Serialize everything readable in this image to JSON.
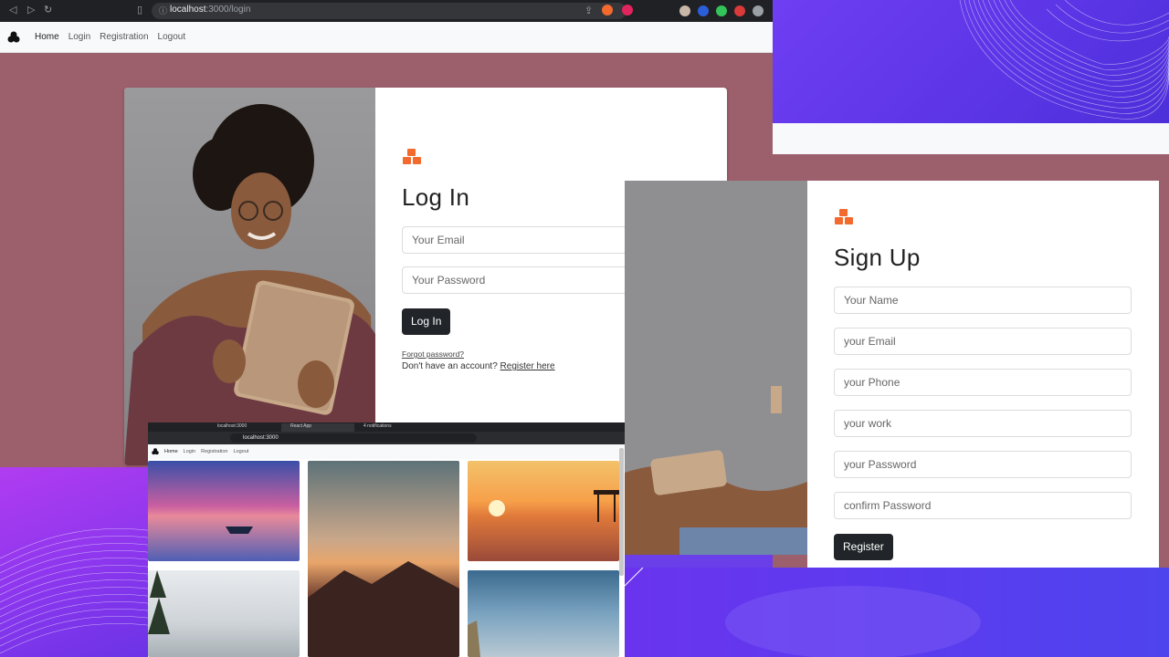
{
  "login_window": {
    "url_host": "localhost",
    "url_path": ":3000/login",
    "nav": {
      "items": [
        "Home",
        "Login",
        "Registration",
        "Logout"
      ]
    },
    "form": {
      "title": "Log In",
      "email_placeholder": "Your Email",
      "password_placeholder": "Your Password",
      "submit_label": "Log In",
      "forgot_link": "Forgot password?",
      "no_account_text": "Don't have an account?",
      "register_link": "Register here"
    }
  },
  "signup_window": {
    "form": {
      "title": "Sign Up",
      "name_placeholder": "Your Name",
      "email_placeholder": "your Email",
      "phone_placeholder": "your Phone",
      "work_placeholder": "your work",
      "password_placeholder": "your Password",
      "confirm_placeholder": "confirm Password",
      "submit_label": "Register"
    }
  },
  "gallery_window": {
    "tabs": [
      "localhost:3000",
      "React App",
      "4 notifications"
    ],
    "url": "localhost:3000",
    "nav": {
      "items": [
        "Home",
        "Login",
        "Registration",
        "Logout"
      ]
    }
  },
  "colors": {
    "page_bg": "#9c5f6c",
    "accent_icon": "#f26a2e",
    "button_dark": "#212529",
    "purple_bg": "#6a3ee8"
  }
}
